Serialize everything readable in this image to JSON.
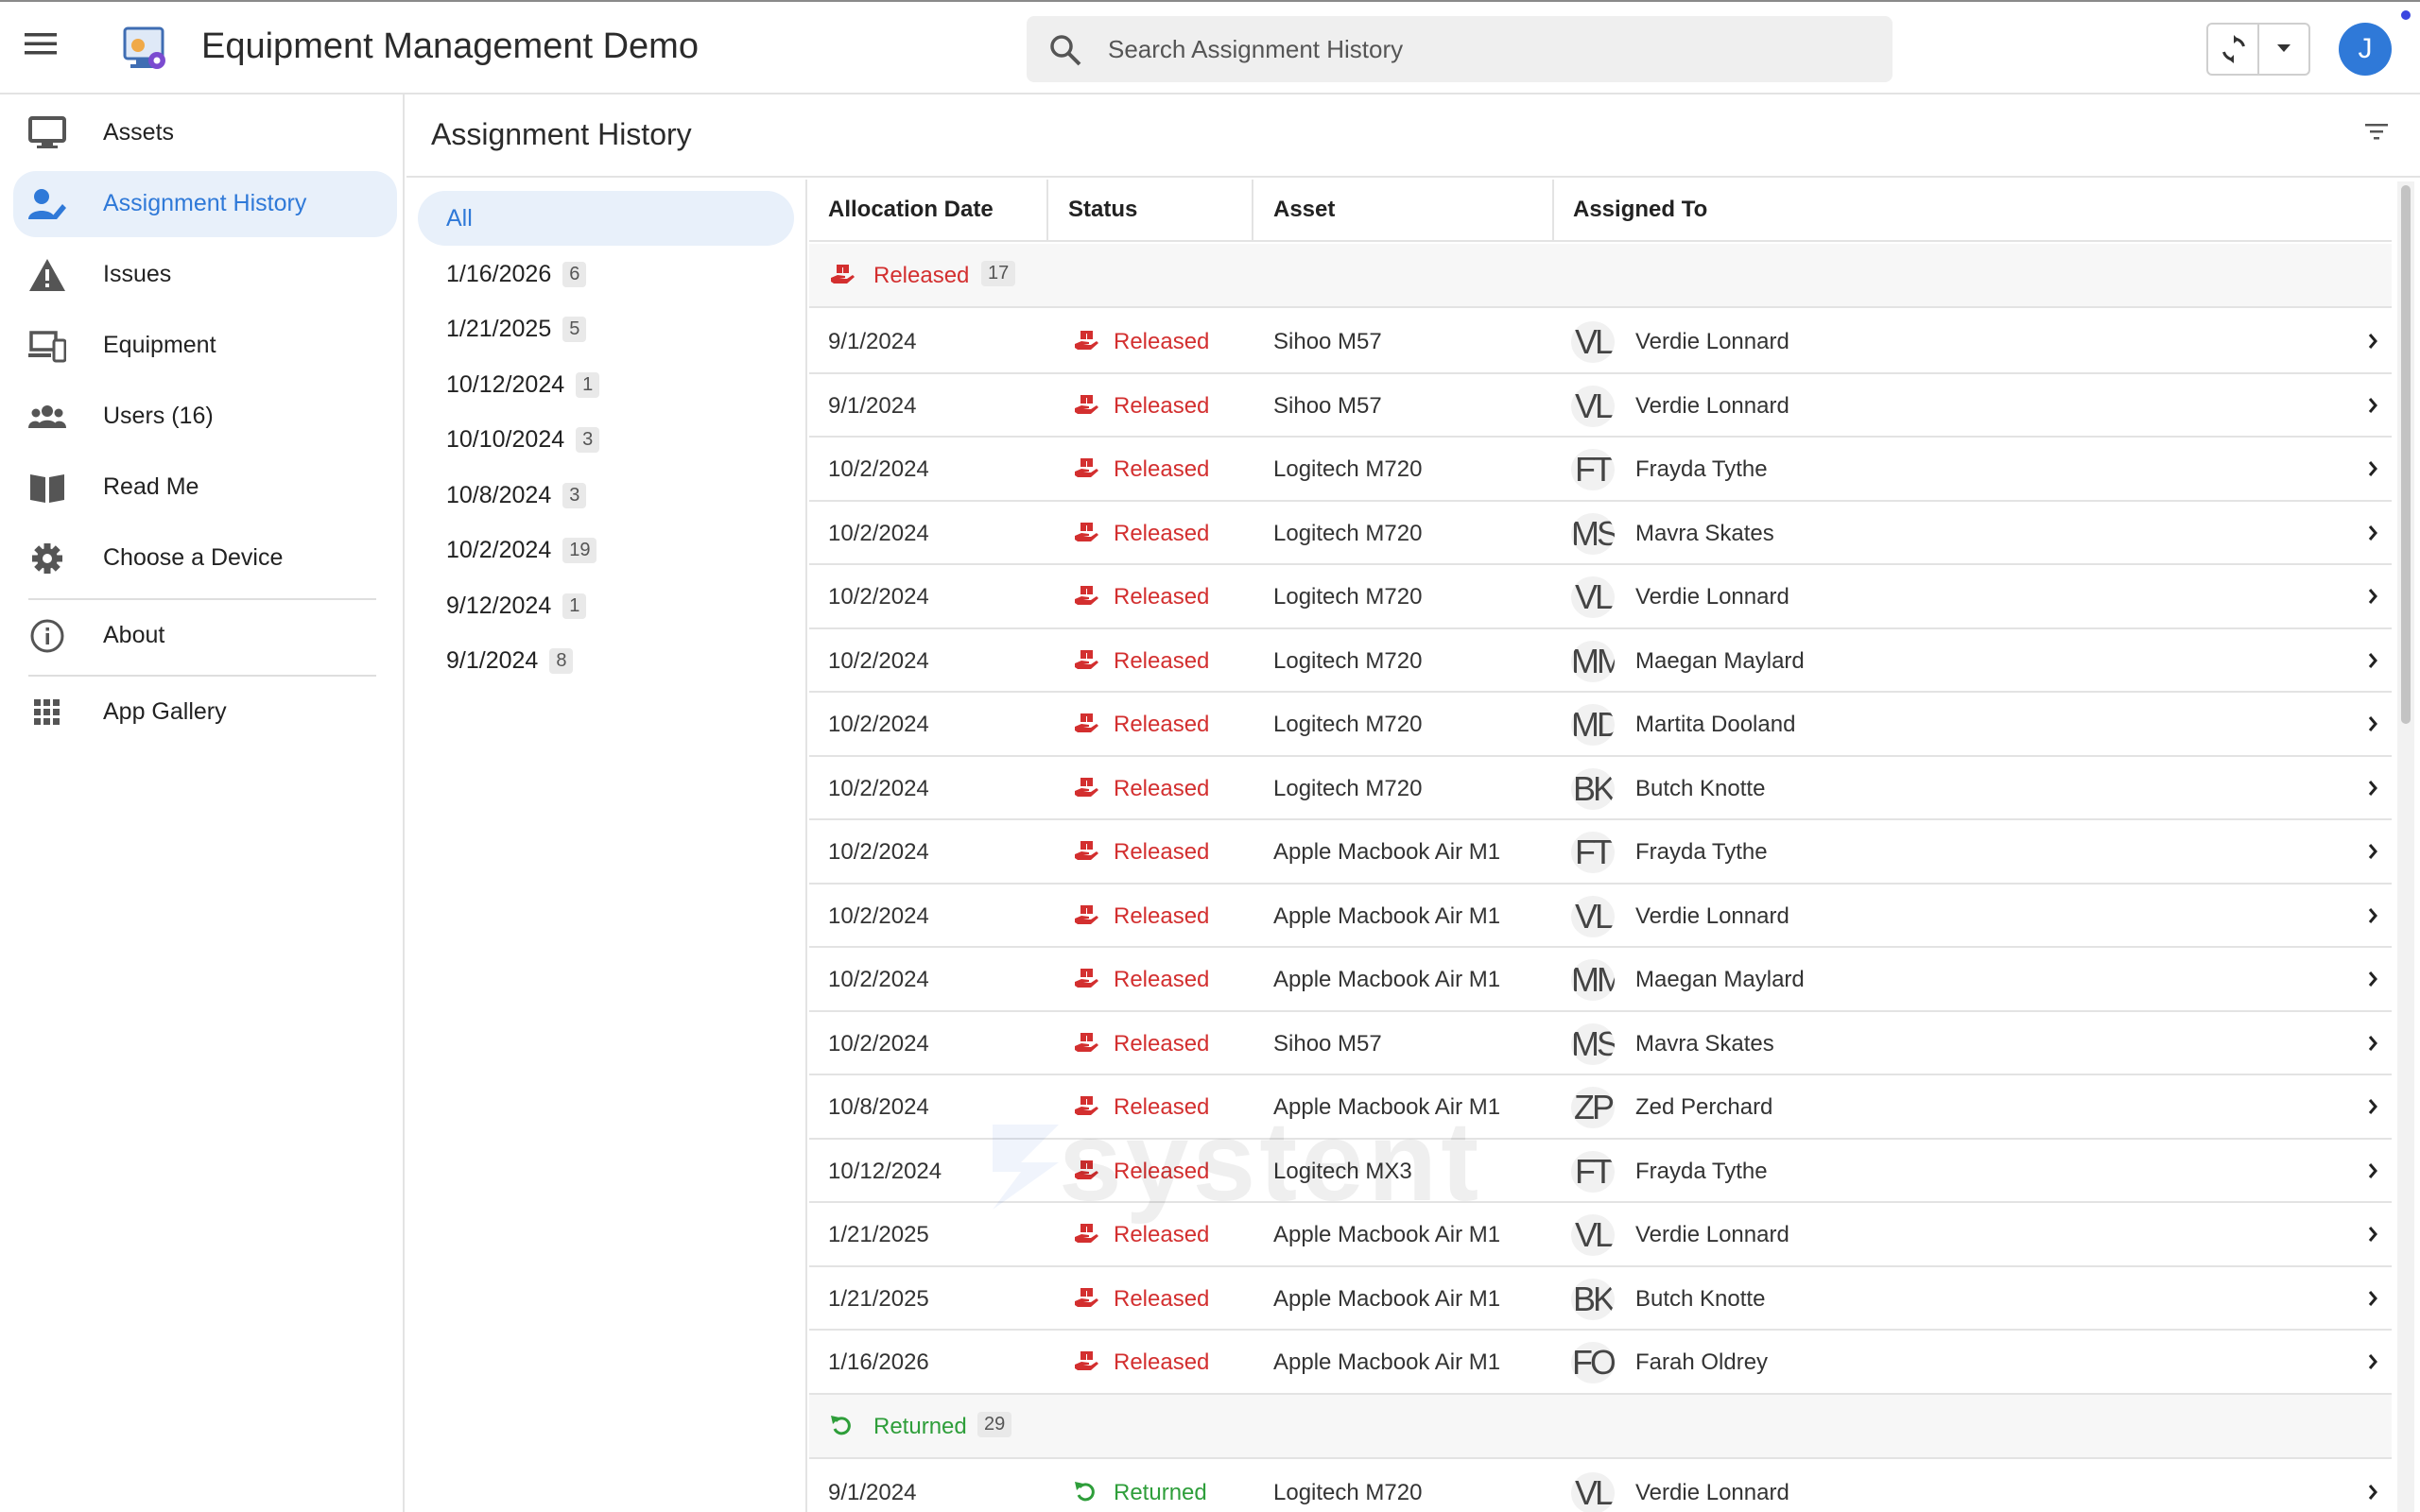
{
  "header": {
    "title": "Equipment Management Demo",
    "search_placeholder": "Search Assignment History",
    "avatar_initial": "J"
  },
  "sidebar": {
    "items": [
      {
        "label": "Assets",
        "icon": "monitor-icon"
      },
      {
        "label": "Assignment History",
        "icon": "user-edit-icon"
      },
      {
        "label": "Issues",
        "icon": "warning-icon"
      },
      {
        "label": "Equipment",
        "icon": "devices-icon"
      },
      {
        "label": "Users (16)",
        "icon": "users-icon"
      },
      {
        "label": "Read Me",
        "icon": "book-icon"
      },
      {
        "label": "Choose a Device",
        "icon": "gear-icon"
      },
      {
        "label": "About",
        "icon": "info-icon"
      },
      {
        "label": "App Gallery",
        "icon": "grid-icon"
      }
    ]
  },
  "page": {
    "title": "Assignment History"
  },
  "groups": [
    {
      "label": "All",
      "count": ""
    },
    {
      "label": "1/16/2026",
      "count": "6"
    },
    {
      "label": "1/21/2025",
      "count": "5"
    },
    {
      "label": "10/12/2024",
      "count": "1"
    },
    {
      "label": "10/10/2024",
      "count": "3"
    },
    {
      "label": "10/8/2024",
      "count": "3"
    },
    {
      "label": "10/2/2024",
      "count": "19"
    },
    {
      "label": "9/12/2024",
      "count": "1"
    },
    {
      "label": "9/1/2024",
      "count": "8"
    }
  ],
  "table": {
    "columns": [
      "Allocation Date",
      "Status",
      "Asset",
      "Assigned To"
    ],
    "status_groups": [
      {
        "label": "Released",
        "count": "17",
        "color": "#d32f2f"
      },
      {
        "label": "Returned",
        "count": "29",
        "color": "#2e9e3a"
      }
    ],
    "released_rows": [
      {
        "date": "9/1/2024",
        "status": "Released",
        "asset": "Sihoo M57",
        "initials": "VL",
        "name": "Verdie Lonnard"
      },
      {
        "date": "9/1/2024",
        "status": "Released",
        "asset": "Sihoo M57",
        "initials": "VL",
        "name": "Verdie Lonnard"
      },
      {
        "date": "10/2/2024",
        "status": "Released",
        "asset": "Logitech M720",
        "initials": "FT",
        "name": "Frayda Tythe"
      },
      {
        "date": "10/2/2024",
        "status": "Released",
        "asset": "Logitech M720",
        "initials": "MS",
        "name": "Mavra Skates"
      },
      {
        "date": "10/2/2024",
        "status": "Released",
        "asset": "Logitech M720",
        "initials": "VL",
        "name": "Verdie Lonnard"
      },
      {
        "date": "10/2/2024",
        "status": "Released",
        "asset": "Logitech M720",
        "initials": "MM",
        "name": "Maegan Maylard"
      },
      {
        "date": "10/2/2024",
        "status": "Released",
        "asset": "Logitech M720",
        "initials": "MD",
        "name": "Martita Dooland"
      },
      {
        "date": "10/2/2024",
        "status": "Released",
        "asset": "Logitech M720",
        "initials": "BK",
        "name": "Butch Knotte"
      },
      {
        "date": "10/2/2024",
        "status": "Released",
        "asset": "Apple Macbook Air M1",
        "initials": "FT",
        "name": "Frayda Tythe"
      },
      {
        "date": "10/2/2024",
        "status": "Released",
        "asset": "Apple Macbook Air M1",
        "initials": "VL",
        "name": "Verdie Lonnard"
      },
      {
        "date": "10/2/2024",
        "status": "Released",
        "asset": "Apple Macbook Air M1",
        "initials": "MM",
        "name": "Maegan Maylard"
      },
      {
        "date": "10/2/2024",
        "status": "Released",
        "asset": "Sihoo M57",
        "initials": "MS",
        "name": "Mavra Skates"
      },
      {
        "date": "10/8/2024",
        "status": "Released",
        "asset": "Apple Macbook Air M1",
        "initials": "ZP",
        "name": "Zed Perchard"
      },
      {
        "date": "10/12/2024",
        "status": "Released",
        "asset": "Logitech MX3",
        "initials": "FT",
        "name": "Frayda Tythe"
      },
      {
        "date": "1/21/2025",
        "status": "Released",
        "asset": "Apple Macbook Air M1",
        "initials": "VL",
        "name": "Verdie Lonnard"
      },
      {
        "date": "1/21/2025",
        "status": "Released",
        "asset": "Apple Macbook Air M1",
        "initials": "BK",
        "name": "Butch Knotte"
      },
      {
        "date": "1/16/2026",
        "status": "Released",
        "asset": "Apple Macbook Air M1",
        "initials": "FO",
        "name": "Farah Oldrey"
      }
    ],
    "returned_rows": [
      {
        "date": "9/1/2024",
        "status": "Returned",
        "asset": "Logitech M720",
        "initials": "VL",
        "name": "Verdie Lonnard"
      }
    ]
  },
  "watermark": "systent"
}
